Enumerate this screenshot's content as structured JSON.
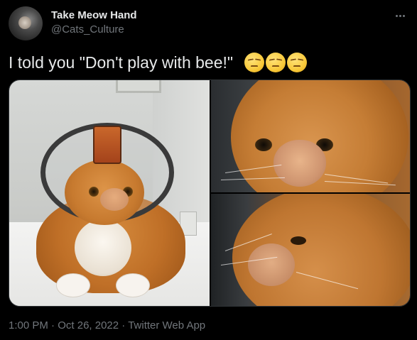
{
  "author": {
    "name": "Take Meow Hand",
    "handle": "@Cats_Culture"
  },
  "tweet": {
    "text": "I told you \"Don't play with bee!\"",
    "emojis": [
      "unamused-face-icon",
      "unamused-face-icon",
      "unamused-face-icon"
    ]
  },
  "media": {
    "photos": [
      "cat-in-cone-photo",
      "cat-swollen-face-closeup-photo",
      "cat-swollen-nose-side-photo"
    ]
  },
  "meta": {
    "time": "1:00 PM",
    "separator": "·",
    "date": "Oct 26, 2022",
    "source": "Twitter Web App"
  },
  "colors": {
    "background": "#000000",
    "text_primary": "#e7e9ea",
    "text_secondary": "#71767b",
    "border": "#2f3336"
  }
}
